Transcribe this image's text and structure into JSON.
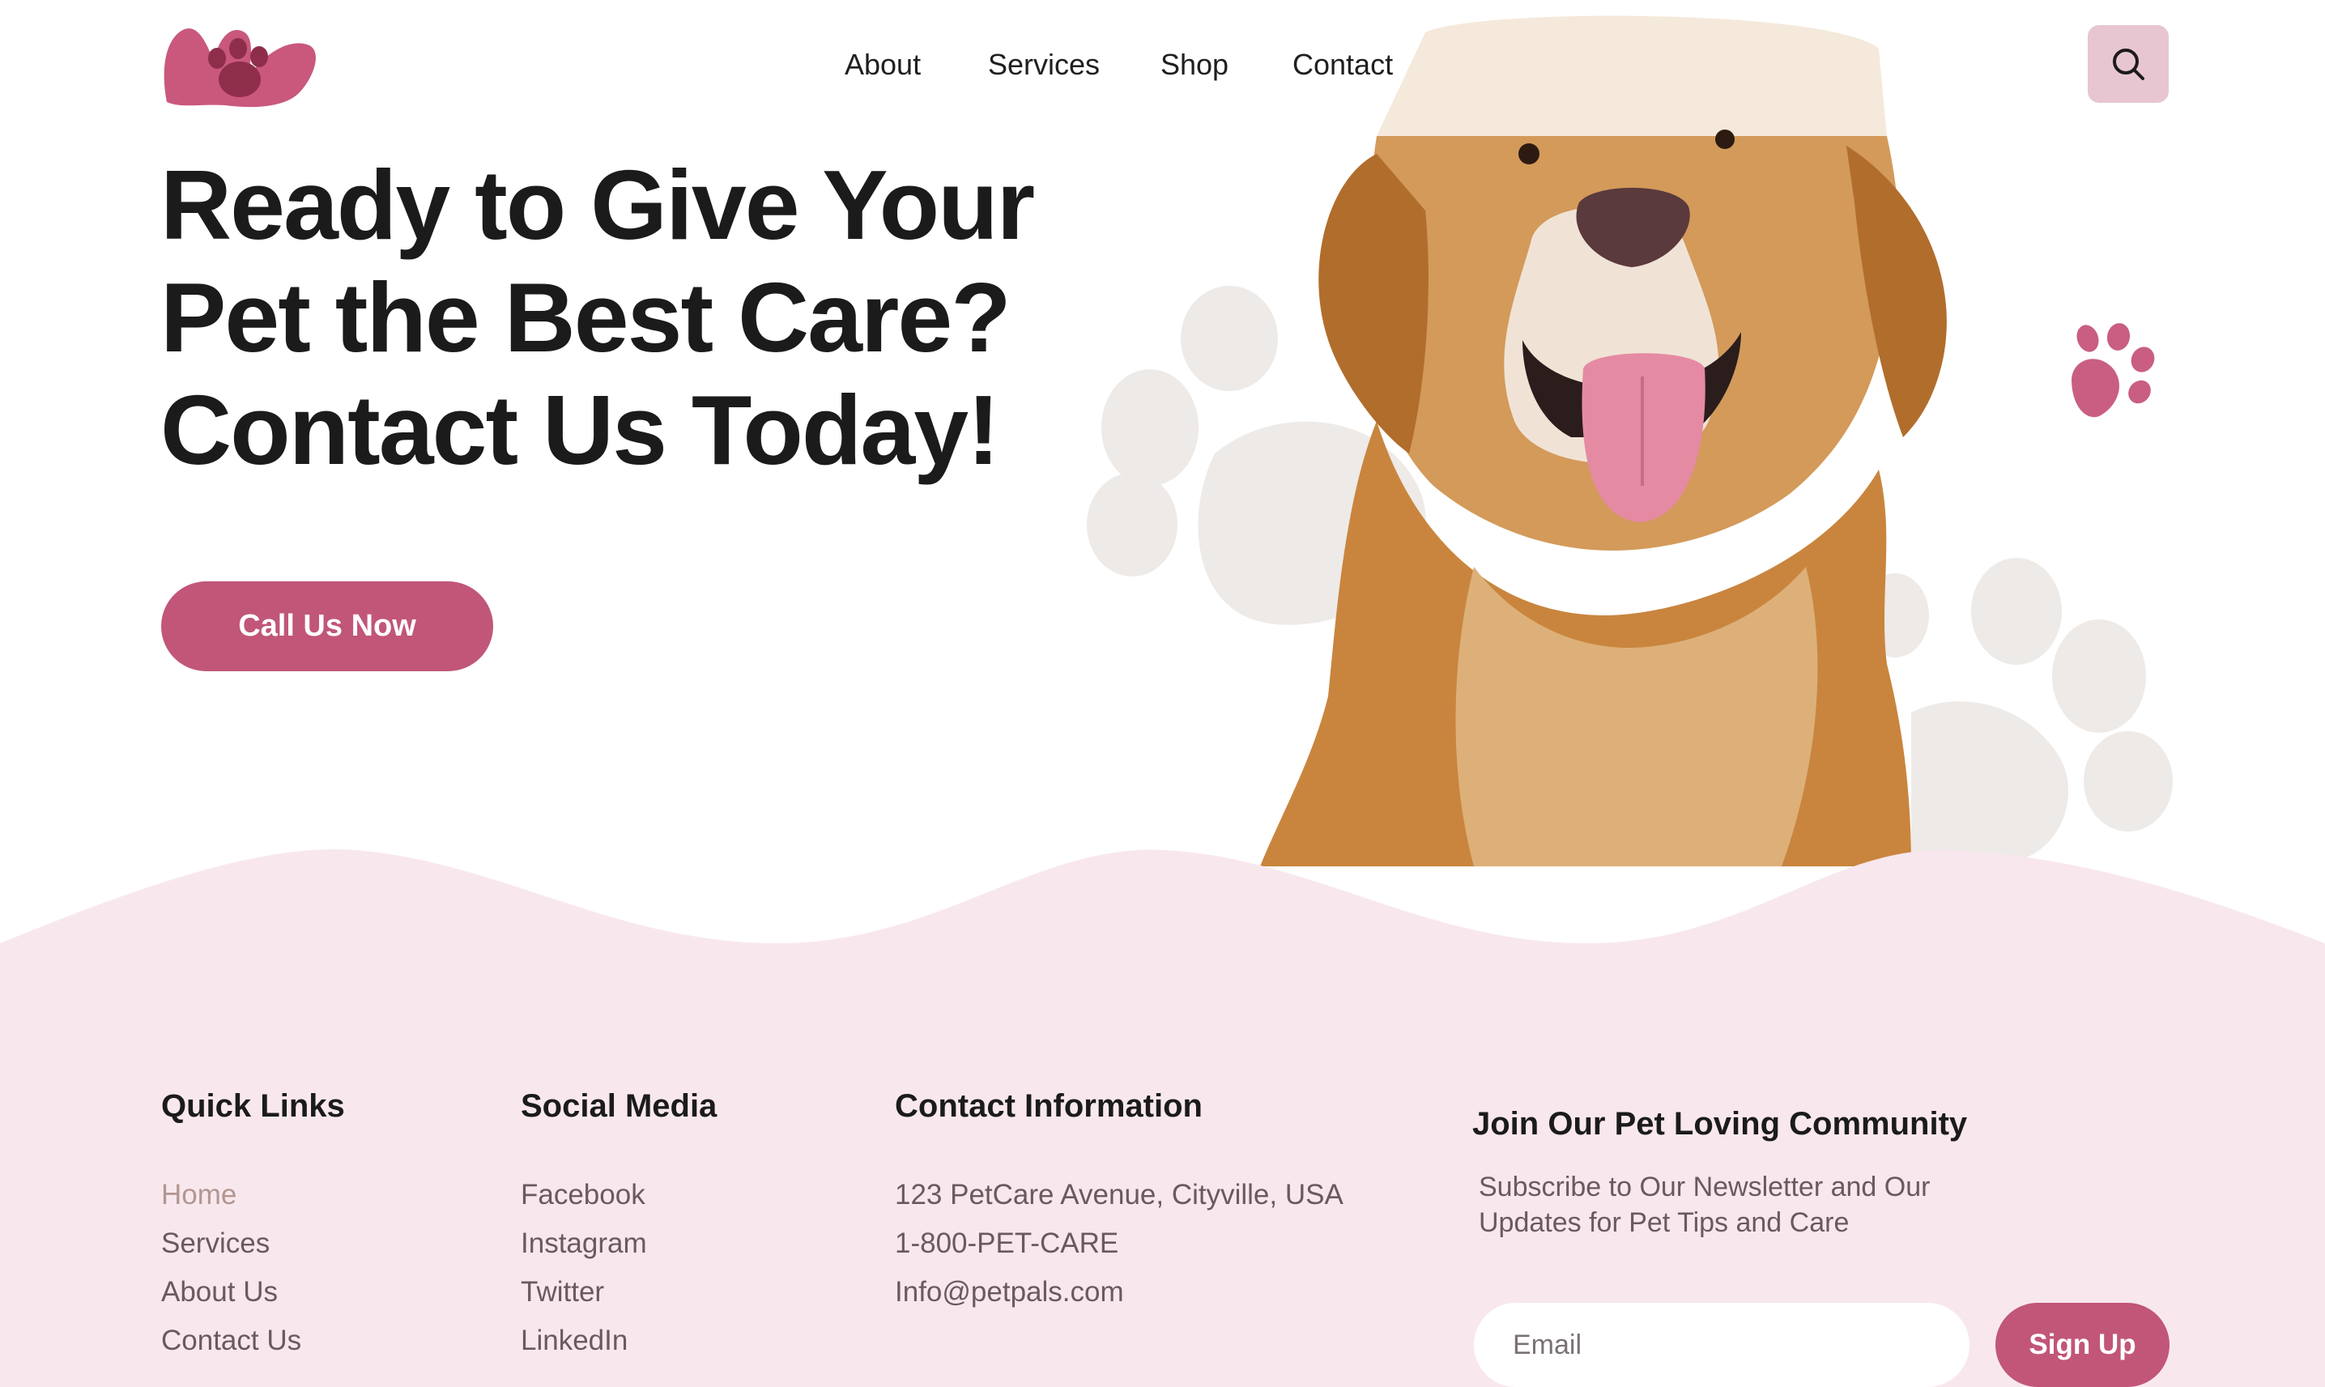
{
  "nav": {
    "items": [
      "About",
      "Services",
      "Shop",
      "Contact"
    ]
  },
  "hero": {
    "title_lines": [
      "Ready to Give Your",
      "Pet the Best Care?",
      "Contact Us Today!"
    ],
    "cta_label": "Call Us Now"
  },
  "footer": {
    "quick_links": {
      "heading": "Quick Links",
      "items": [
        "Home",
        "Services",
        "About Us",
        "Contact Us"
      ]
    },
    "social": {
      "heading": "Social Media",
      "items": [
        "Facebook",
        "Instagram",
        "Twitter",
        "LinkedIn"
      ]
    },
    "contact": {
      "heading": "Contact Information",
      "items": [
        "123 PetCare Avenue, Cityville, USA",
        "1-800-PET-CARE",
        "Info@petpals.com"
      ]
    },
    "newsletter": {
      "heading": "Join Our Pet Loving Community",
      "text": "Subscribe to Our Newsletter and Our Updates for Pet Tips and Care",
      "email_placeholder": "Email",
      "signup_label": "Sign Up"
    }
  },
  "colors": {
    "accent": "#c15678",
    "footer_bg": "#f8e8ee",
    "search_bg": "#e7c6d1",
    "paw_grey": "#eeeae8"
  },
  "icons": {
    "logo": "paw-logo",
    "search": "search-icon",
    "decor": "paw-icon"
  }
}
